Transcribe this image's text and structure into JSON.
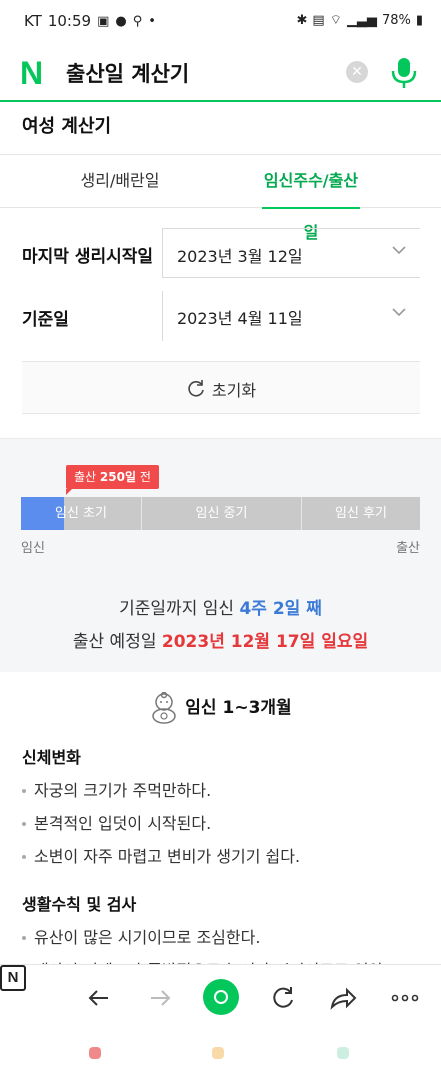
{
  "status_bar": {
    "carrier": "KT",
    "time": "10:59",
    "battery": "78%"
  },
  "search": {
    "logo": "N",
    "query": "출산일 계산기"
  },
  "calculator": {
    "title": "여성 계산기",
    "tabs": [
      {
        "label": "생리/배란일",
        "active": false
      },
      {
        "label": "임신주수/출산일",
        "active": true
      }
    ],
    "fields": [
      {
        "label": "마지막 생리시작일",
        "value": "2023년 3월 12일"
      },
      {
        "label": "기준일",
        "value": "2023년 4월 11일"
      }
    ],
    "reset_label": "초기화"
  },
  "progress": {
    "badge_prefix": "출산 ",
    "badge_days": "250일",
    "badge_suffix": " 전",
    "segments": [
      "임신 초기",
      "임신 중기",
      "임신 후기"
    ],
    "start_label": "임신",
    "end_label": "출산",
    "fraction_of_first_segment": 0.36,
    "fill_color": "#5b8def"
  },
  "summary": {
    "line1_prefix": "기준일까지 임신 ",
    "line1_highlight": "4주 2일 째",
    "line2_prefix": "출산 예정일 ",
    "line2_highlight": "2023년 12월 17일 일요일"
  },
  "phase": {
    "title": "임신 1~3개월",
    "body_change_title": "신체변화",
    "body_changes": [
      "자궁의 크기가 주먹만하다.",
      "본격적인 입덧이 시작된다.",
      "소변이 자주 마렵고 변비가 생기기 쉽다."
    ],
    "life_rules_title": "생활수칙 및 검사",
    "life_rules": [
      "유산이 많은 시기이므로 조심한다.",
      "태아의 뇌세포가 폭발적으로 늘어나 시기이므로 영양"
    ]
  },
  "colors": {
    "brand_green": "#03c75a",
    "highlight_blue": "#3b7ad6",
    "highlight_red": "#e5383b",
    "badge_red": "#f14a4a"
  }
}
